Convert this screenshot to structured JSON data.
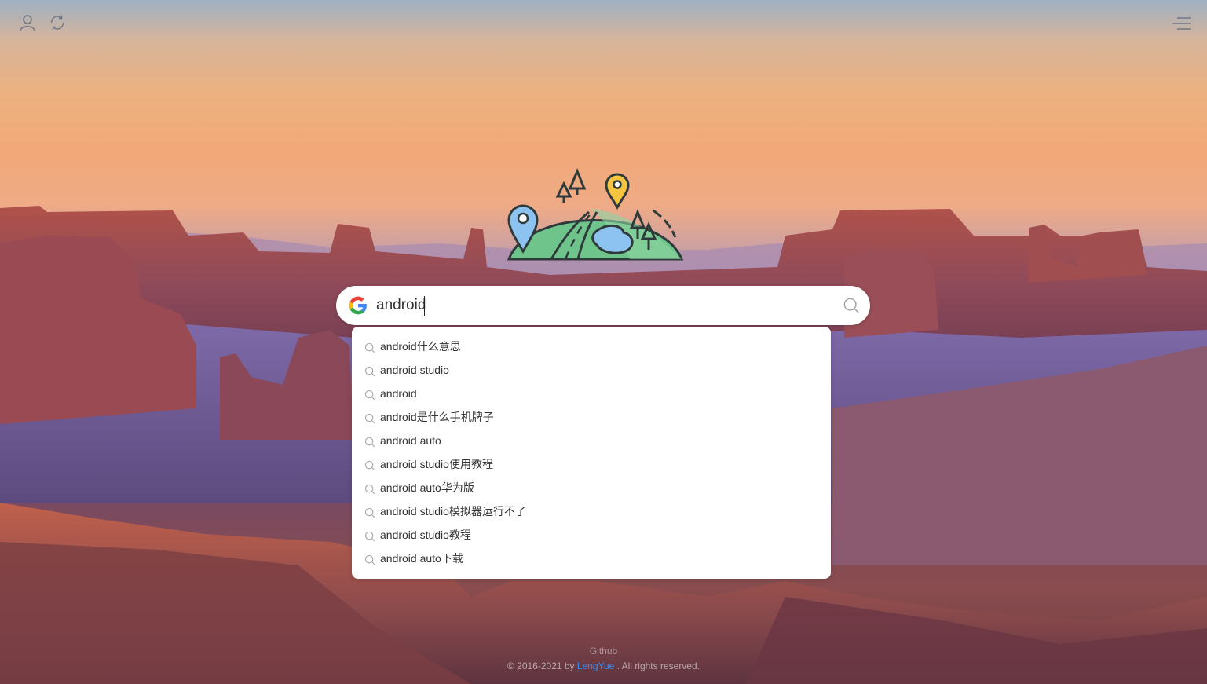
{
  "header": {
    "user_icon": "user-icon",
    "refresh_icon": "refresh-icon",
    "menu_icon": "menu-icon"
  },
  "logo": {
    "icon": "map-hill-logo"
  },
  "search": {
    "engine_icon": "google-g-icon",
    "value": "android",
    "submit_icon": "search-icon"
  },
  "suggestions": [
    "android什么意思",
    "android studio",
    "android",
    "android是什么手机牌子",
    "android auto",
    "android studio使用教程",
    "android auto华为版",
    "android studio模拟器运行不了",
    "android studio教程",
    "android auto下载"
  ],
  "footer": {
    "github": "Github",
    "copy_prefix": "© 2016-2021 by ",
    "author": "LengYue",
    "copy_suffix": " . All rights reserved."
  },
  "colors": {
    "author_link": "#3d8cf0",
    "logo_green": "#6ec48a",
    "pin_blue": "#8cc3f0",
    "pin_yellow": "#f5c542"
  }
}
